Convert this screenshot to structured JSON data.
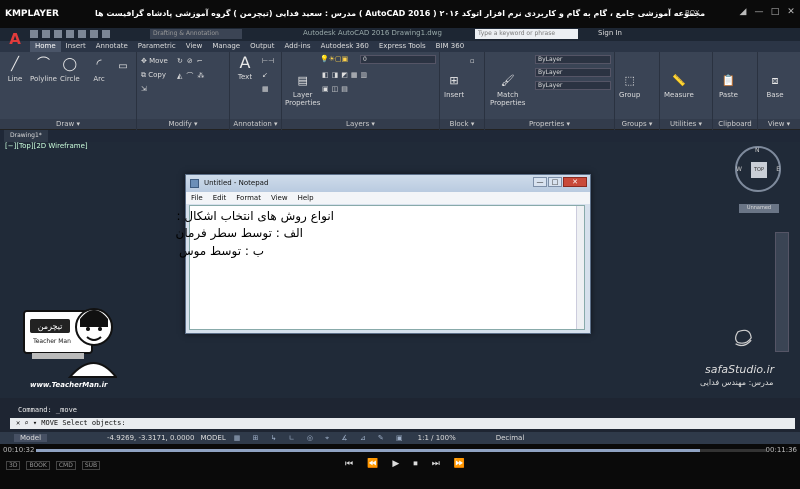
{
  "kmplayer": {
    "logo": "KMPLAYER",
    "video_title": "مجموعه آموزشی جامع ، گام به گام و کاربردی نرم افزار اتوکد ۲۰۱۶ ( AutoCAD 2016 ) مدرس : سعید فدایی (تیچرمن ) گروه آموزشی پادشاه گرافیست ها",
    "box_label": "BOX",
    "window_buttons": [
      "◢",
      "—",
      "□",
      "✕"
    ],
    "time_elapsed": "00:10:32",
    "time_total": "00:11:36",
    "progress": 0.91,
    "controls": [
      "⏮",
      "⏪",
      "▶",
      "⏹",
      "⏭",
      "⏩"
    ],
    "left_buttons": [
      "3D",
      "BOOK",
      "CMD",
      "SUB"
    ]
  },
  "autocad": {
    "app_letter": "A",
    "workspace": "Drafting & Annotation",
    "doc_title": "Autodesk AutoCAD 2016  Drawing1.dwg",
    "search_placeholder": "Type a keyword or phrase",
    "sign_in": "Sign In",
    "tabs": [
      "Home",
      "Insert",
      "Annotate",
      "Parametric",
      "View",
      "Manage",
      "Output",
      "Add-ins",
      "Autodesk 360",
      "Express Tools",
      "BIM 360"
    ],
    "panels": {
      "draw": {
        "title": "Draw ▾",
        "tools": [
          "Line",
          "Polyline",
          "Circle",
          "Arc"
        ]
      },
      "modify": {
        "title": "Modify ▾",
        "tools": [
          "Move",
          "Copy"
        ]
      },
      "annotation": {
        "title": "Annotation ▾",
        "tools": [
          "Text"
        ]
      },
      "layers": {
        "title": "Layers ▾",
        "tools": [
          "Layer",
          "Properties"
        ],
        "layer_value": "0"
      },
      "block": {
        "title": "Block ▾",
        "tools": [
          "Insert"
        ]
      },
      "properties": {
        "title": "Properties ▾",
        "tools": [
          "Match",
          "Properties"
        ],
        "bylayer": [
          "ByLayer",
          "ByLayer",
          "ByLayer"
        ]
      },
      "groups": {
        "title": "Groups ▾",
        "tools": [
          "Group"
        ]
      },
      "utilities": {
        "title": "Utilities ▾",
        "tools": [
          "Measure"
        ]
      },
      "clipboard": {
        "title": "Clipboard",
        "tools": [
          "Paste"
        ]
      },
      "view": {
        "title": "View ▾",
        "tools": [
          "Base"
        ]
      }
    },
    "drawing_tab": "Drawing1*",
    "viewport_label": "[−][Top][2D Wireframe]",
    "viewcube": {
      "face": "TOP",
      "n": "N",
      "w": "W",
      "e": "E",
      "unnamed": "Unnamed"
    },
    "command_history": "Command: _move",
    "command_prompt": "✕ ⌕ ▾ MOVE Select objects:",
    "status": {
      "model_tab": "Model",
      "coords": "-4.9269, -3.3171, 0.0000",
      "mode": "MODEL",
      "scale": "1:1 / 100%",
      "units": "Decimal"
    }
  },
  "notepad": {
    "title": "Untitled - Notepad",
    "buttons": [
      "—",
      "□",
      "✕"
    ],
    "menu": [
      "File",
      "Edit",
      "Format",
      "View",
      "Help"
    ],
    "lines": [
      "انواع روش های انتخاب اشکال :",
      "الف : توسط سطر فرمان",
      "ب : توسط موس"
    ]
  },
  "watermarks": {
    "teacherman_url": "www.TeacherMan.ir",
    "teacherman_logo_text": "تیچرمن",
    "teacherman_sub": "Teacher Man",
    "safa_site": "safaStudio.ir",
    "safa_teacher": "مدرس: مهندس فدایی"
  },
  "colors": {
    "ribbon": "#3a4455",
    "canvas": "#202a38",
    "accent": "#e23b3b"
  }
}
